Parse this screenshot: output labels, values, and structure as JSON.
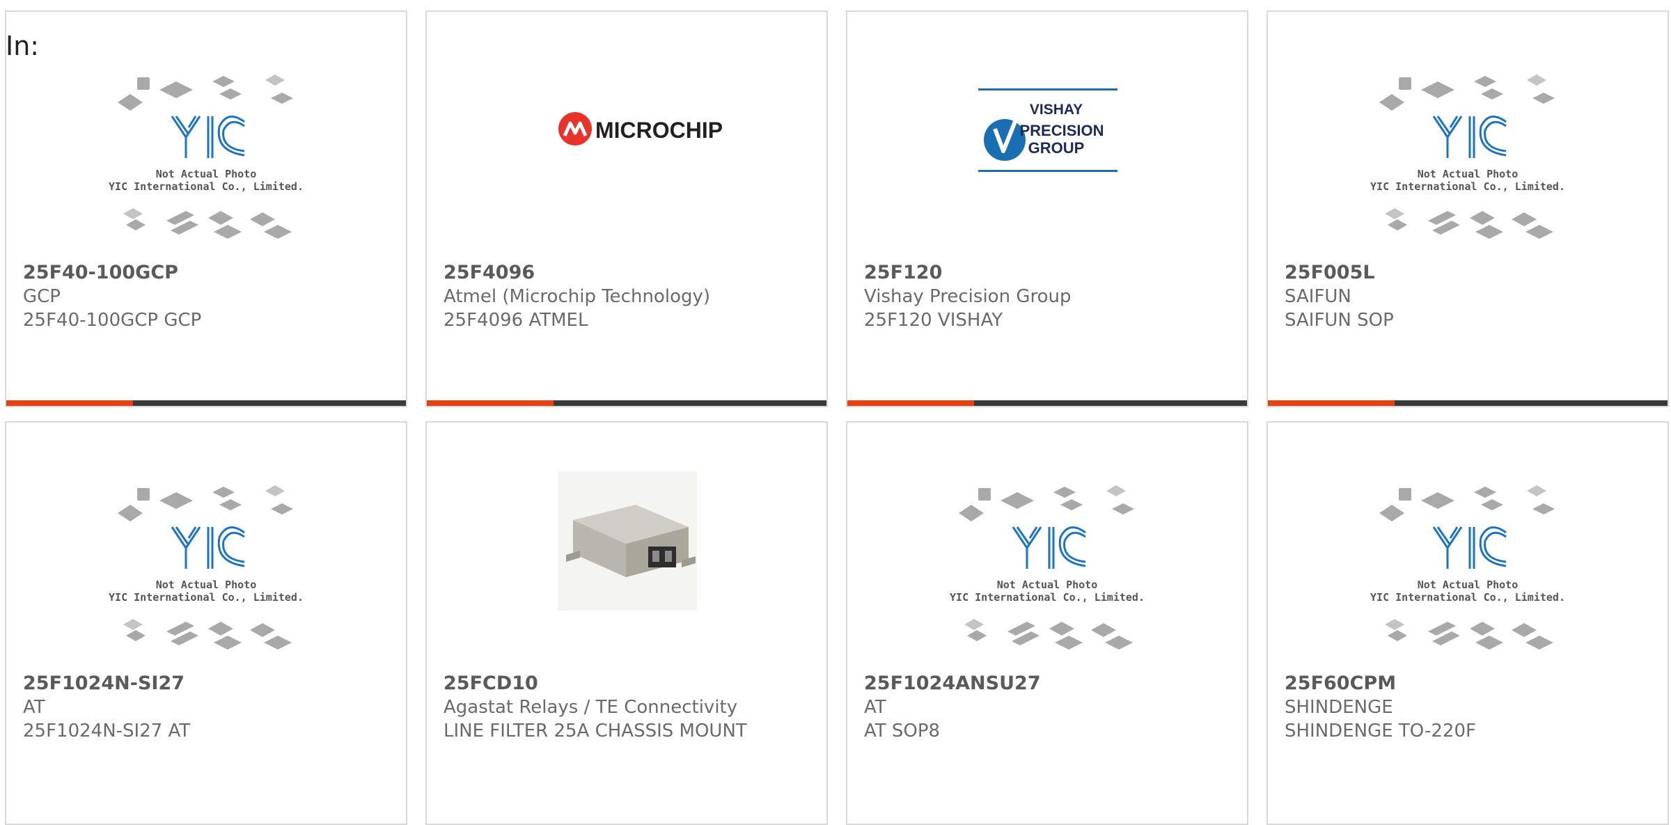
{
  "header": {
    "in_label": "In:"
  },
  "placeholder": {
    "line1": "Not Actual Photo",
    "line2": "YIC International Co., Limited.",
    "logo_text": "YIC",
    "colors": {
      "logo": "#1a73c8",
      "chips": "#a9a9a9",
      "text": "#555555"
    }
  },
  "microchip_logo": {
    "text": "MICROCHIP",
    "color": "#e8322a"
  },
  "vishay_logo": {
    "line1": "VISHAY",
    "line2": "PRECISION",
    "line3": "GROUP",
    "color": "#1a6fb3"
  },
  "accent_color": "#e8410f",
  "products": [
    {
      "part": "25F40-100GCP",
      "manufacturer": "GCP",
      "description": "25F40-100GCP GCP",
      "image": "yic-placeholder"
    },
    {
      "part": "25F4096",
      "manufacturer": "Atmel (Microchip Technology)",
      "description": "25F4096 ATMEL",
      "image": "microchip-logo"
    },
    {
      "part": "25F120",
      "manufacturer": "Vishay Precision Group",
      "description": "25F120 VISHAY",
      "image": "vishay-logo"
    },
    {
      "part": "25F005L",
      "manufacturer": "SAIFUN",
      "description": "SAIFUN SOP",
      "image": "yic-placeholder"
    },
    {
      "part": "25F1024N-SI27",
      "manufacturer": "AT",
      "description": "25F1024N-SI27 AT",
      "image": "yic-placeholder"
    },
    {
      "part": "25FCD10",
      "manufacturer": "Agastat Relays / TE Connectivity",
      "description": "LINE FILTER 25A CHASSIS MOUNT",
      "image": "line-filter-photo"
    },
    {
      "part": "25F1024ANSU27",
      "manufacturer": "AT",
      "description": "AT SOP8",
      "image": "yic-placeholder"
    },
    {
      "part": "25F60CPM",
      "manufacturer": "SHINDENGE",
      "description": "SHINDENGE TO-220F",
      "image": "yic-placeholder"
    }
  ]
}
